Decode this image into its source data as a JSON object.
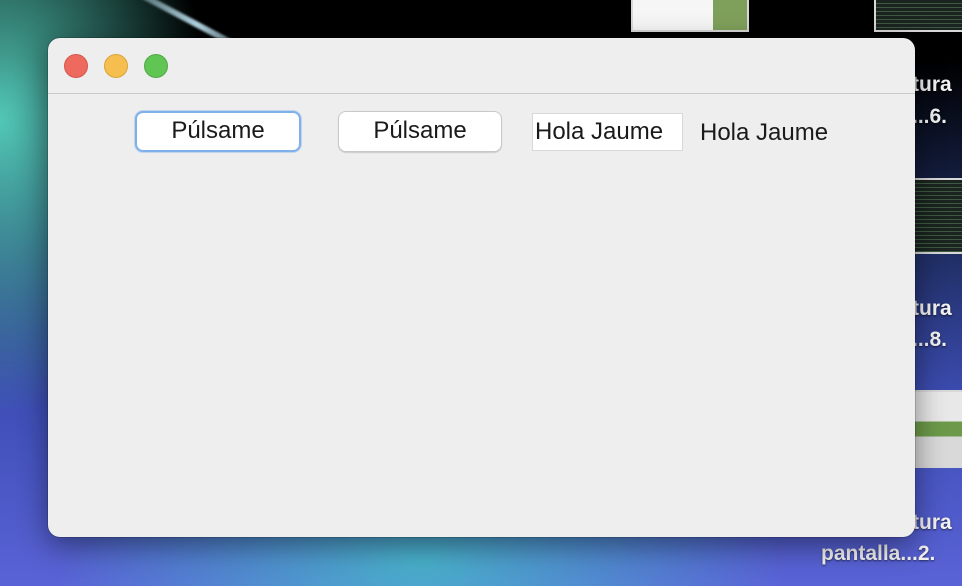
{
  "window": {
    "title": "",
    "buttons": [
      {
        "label": "Púlsame"
      },
      {
        "label": "Púlsame"
      }
    ],
    "text_field": {
      "value": "Hola Jaume"
    },
    "label": "Hola Jaume"
  },
  "desktop": {
    "labels": [
      {
        "text": "tura"
      },
      {
        "text": "...6."
      },
      {
        "text": "tura"
      },
      {
        "text": "...8."
      },
      {
        "text": "tura"
      },
      {
        "text": "pantalla...2."
      }
    ]
  }
}
